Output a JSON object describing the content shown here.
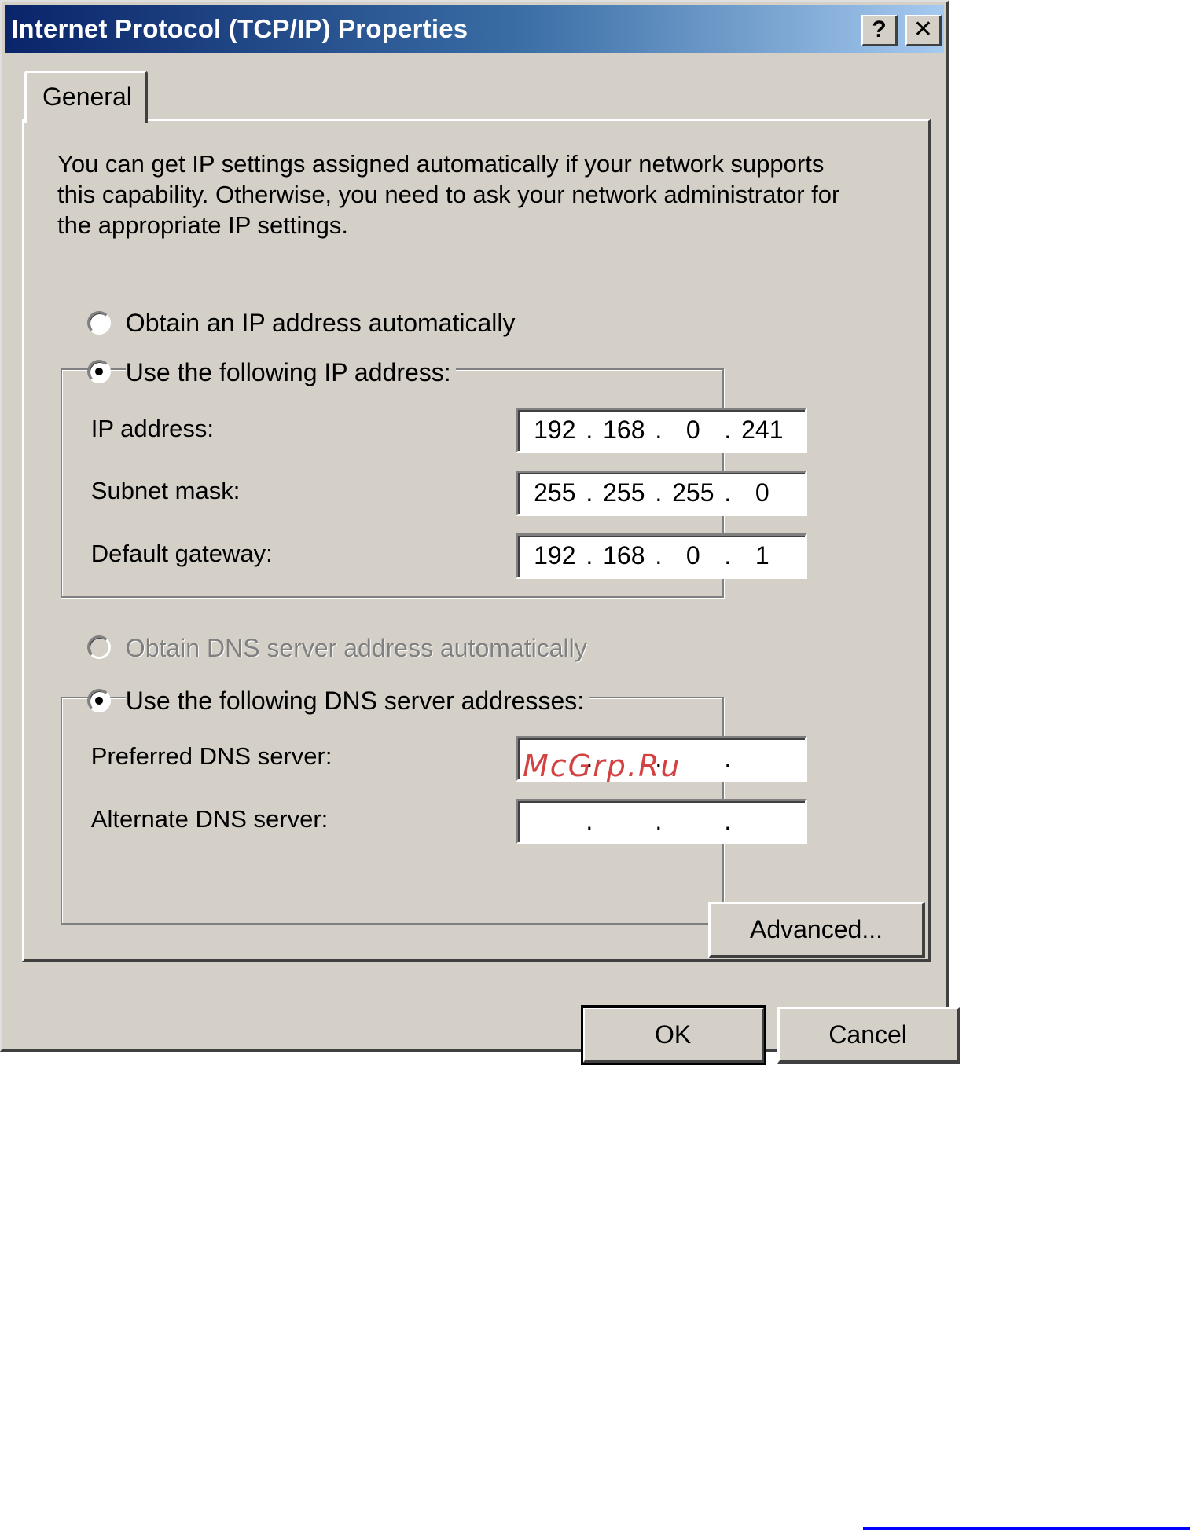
{
  "window": {
    "title": "Internet Protocol (TCP/IP) Properties",
    "help_button": "?",
    "close_button": "✕"
  },
  "tabs": [
    {
      "label": "General",
      "selected": true
    }
  ],
  "intro_text": "You can get IP settings assigned automatically if your network supports\nthis capability. Otherwise, you need to ask your network administrator for\nthe appropriate IP settings.",
  "ip_mode": {
    "auto_label": "Obtain an IP address automatically",
    "manual_label": "Use the following IP address:",
    "selected": "manual"
  },
  "ip_fields": [
    {
      "label": "IP address:",
      "octets": [
        "192",
        "168",
        "0",
        "241"
      ]
    },
    {
      "label": "Subnet mask:",
      "octets": [
        "255",
        "255",
        "255",
        "0"
      ]
    },
    {
      "label": "Default gateway:",
      "octets": [
        "192",
        "168",
        "0",
        "1"
      ]
    }
  ],
  "dns_mode": {
    "auto_label": "Obtain DNS server address automatically",
    "manual_label": "Use the following DNS server addresses:",
    "selected": "manual",
    "auto_disabled": true
  },
  "dns_fields": [
    {
      "label": "Preferred DNS server:",
      "octets": [
        "",
        "",
        "",
        ""
      ]
    },
    {
      "label": "Alternate DNS server:",
      "octets": [
        "",
        "",
        "",
        ""
      ]
    }
  ],
  "buttons": {
    "advanced": "Advanced...",
    "ok": "OK",
    "cancel": "Cancel"
  },
  "watermark": "McGrp.Ru",
  "colors": {
    "face": "#d4d0c8",
    "title_start": "#0a246a",
    "title_end": "#a6caf0"
  }
}
